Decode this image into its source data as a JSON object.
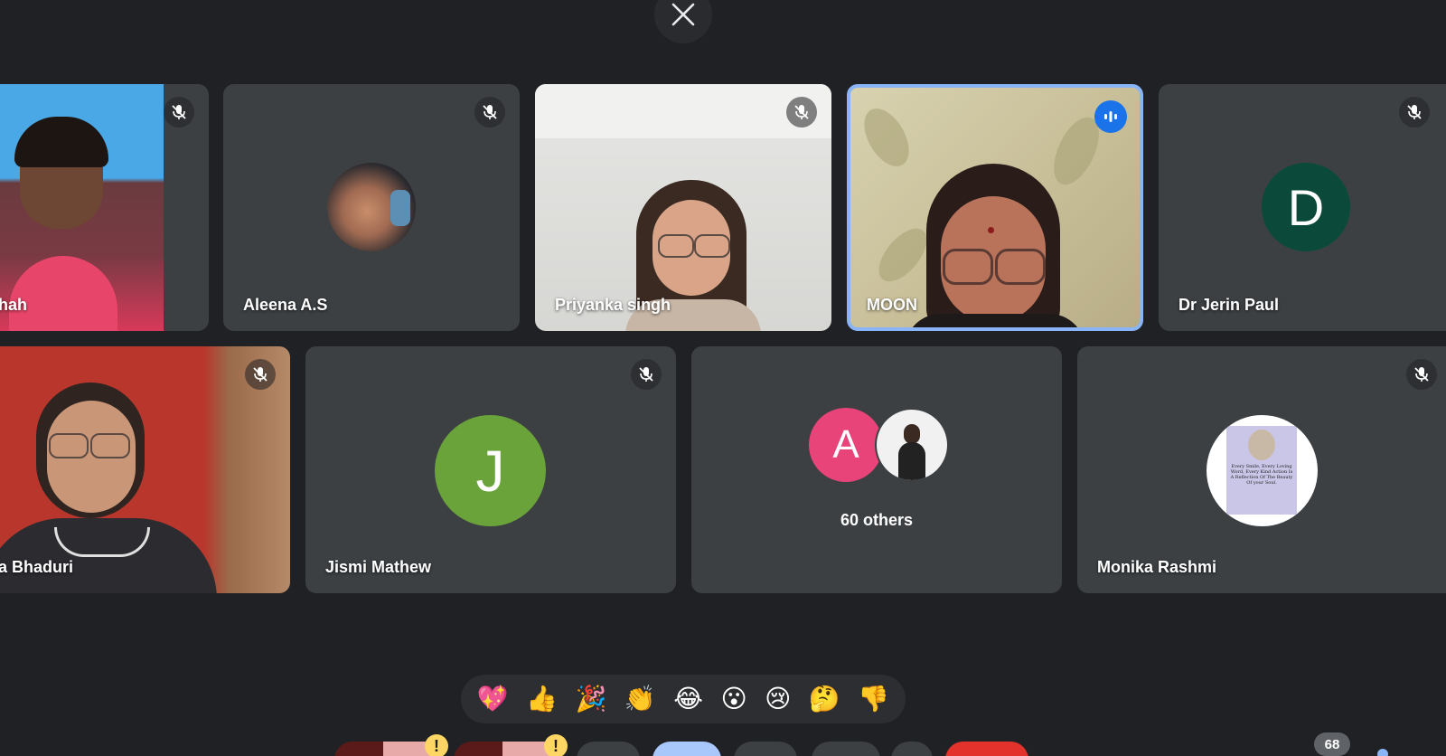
{
  "colors": {
    "background": "#202124",
    "tile": "#3c4043",
    "active_border": "#8ab4f8",
    "speaking_badge": "#1a73e8",
    "avatar_d": "#0b4a3a",
    "avatar_j": "#6aa33a",
    "avatar_a": "#e8447a",
    "end_call": "#e3322b"
  },
  "row1": [
    {
      "name": "hah",
      "muted": true
    },
    {
      "name": "Aleena A.S",
      "muted": true
    },
    {
      "name": "Priyanka singh",
      "muted": true
    },
    {
      "name": "MOON",
      "speaking": true
    },
    {
      "name": "Dr Jerin Paul",
      "muted": true,
      "initial": "D"
    }
  ],
  "row2": [
    {
      "name": "a Bhaduri",
      "muted": true
    },
    {
      "name": "Jismi Mathew",
      "muted": true,
      "initial": "J"
    },
    {
      "name": "",
      "others_label": "60 others",
      "initial": "A"
    },
    {
      "name": "Monika Rashmi",
      "muted": true,
      "avatar_quote": "Every Smile, Every Loving Word, Every Kind Action Is A Reflection Of The Beauty Of your Soul."
    }
  ],
  "reactions": [
    "💖",
    "👍",
    "🎉",
    "👏",
    "😂",
    "😮",
    "😢",
    "🤔",
    "👎"
  ],
  "controls": {
    "warning_mark": "!",
    "participants_count": "68"
  }
}
